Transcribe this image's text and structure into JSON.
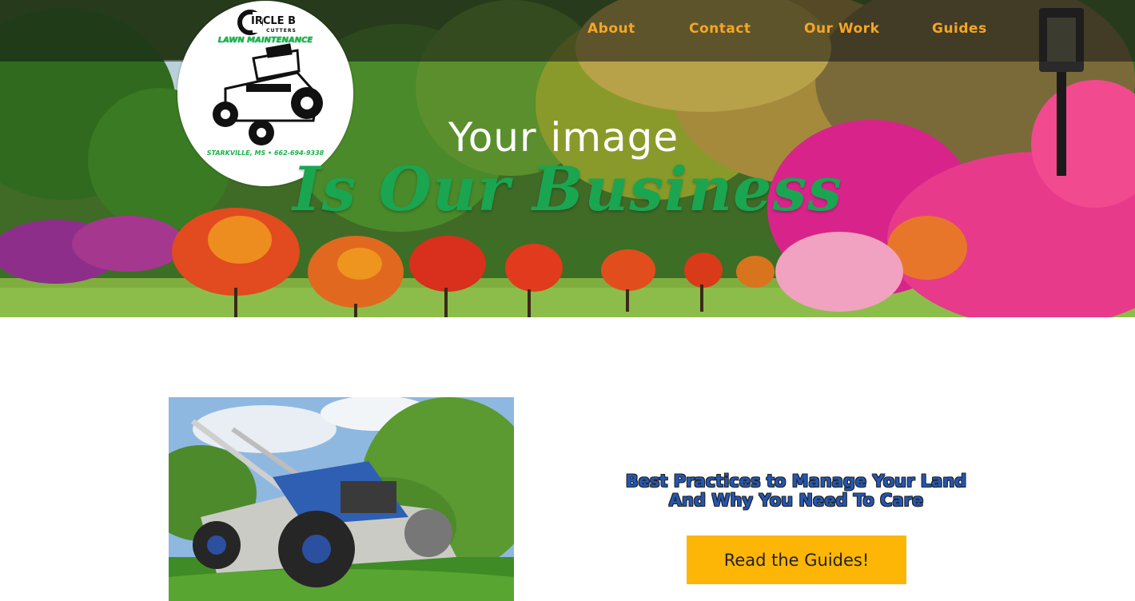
{
  "nav": {
    "items": [
      {
        "label": "About"
      },
      {
        "label": "Contact"
      },
      {
        "label": "Our Work"
      },
      {
        "label": "Guides"
      }
    ]
  },
  "logo": {
    "brand_line1": "IRCLE B",
    "brand_line2": "CUTTERS",
    "service": "LAWN MAINTENANCE",
    "location": "STARKVILLE, MS • 662-694-9338"
  },
  "hero": {
    "tagline_top": "Your image",
    "tagline_bottom": "Is Our Business"
  },
  "cta": {
    "heading_line1": "Best Practices to Manage Your Land",
    "heading_line2": "And Why You Need To Care",
    "button_label": "Read the Guides!"
  },
  "colors": {
    "nav_text": "#f5a623",
    "tagline_green": "#1aa551",
    "button_bg": "#fdb606",
    "heading_blue": "#2257b5"
  }
}
